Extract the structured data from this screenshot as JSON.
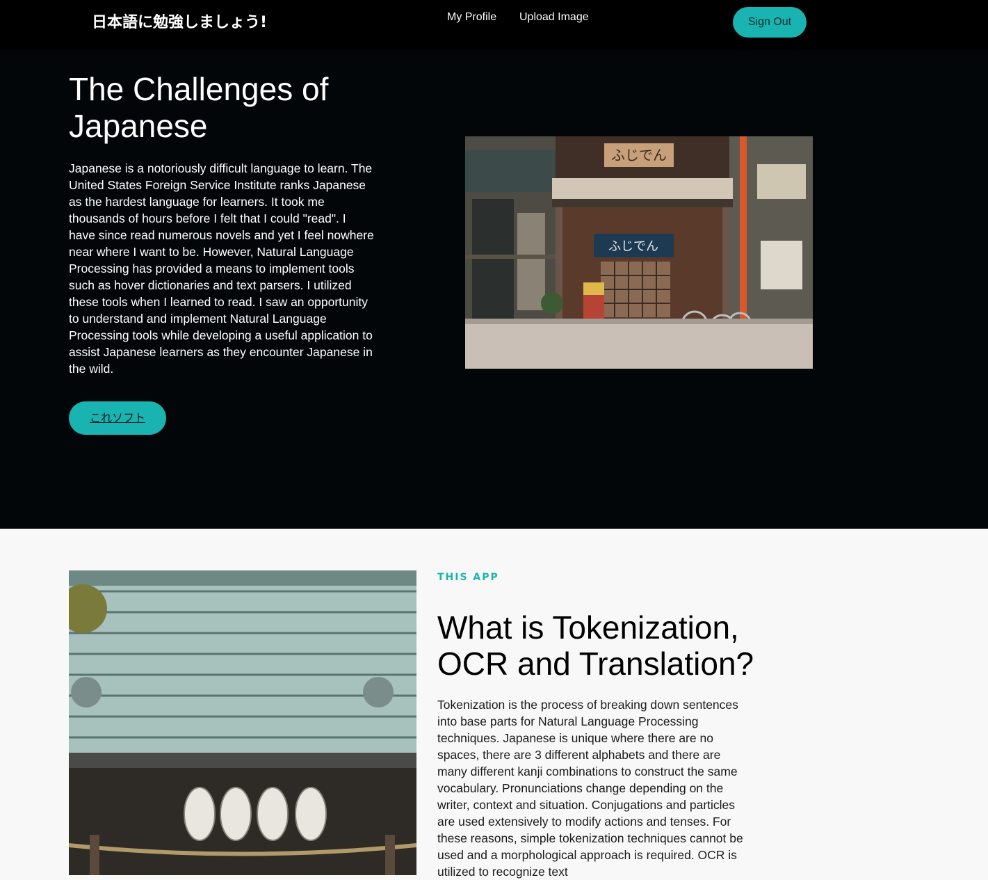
{
  "navbar": {
    "brand": "日本語に勉強しましょう!",
    "links": [
      {
        "label": "My Profile"
      },
      {
        "label": "Upload Image"
      }
    ],
    "sign_out_label": "Sign Out"
  },
  "hero": {
    "title": "The Challenges of Japanese",
    "body": "Japanese is a notoriously difficult language to learn. The United States Foreign Service Institute ranks Japanese as the hardest language for learners. It took me thousands of hours before I felt that I could \"read\". I have since read numerous novels and yet I feel nowhere near where I want to be. However, Natural Language Processing has provided a means to implement tools such as hover dictionaries and text parsers. I utilized these tools when I learned to read. I saw an opportunity to understand and implement Natural Language Processing tools while developing a useful application to assist Japanese learners as they encounter Japanese in the wild.",
    "cta_label": "これソフト",
    "photo_sign_text": "ふじでん"
  },
  "about": {
    "eyebrow": "THIS APP",
    "title": "What is Tokenization, OCR and Translation?",
    "body": "Tokenization is the process of breaking down sentences into base parts for Natural Language Processing techniques. Japanese is unique where there are no spaces, there are 3 different alphabets and there are many different kanji combinations to construct the same vocabulary. Pronunciations change depending on the writer, context and situation. Conjugations and particles are used extensively to modify actions and tenses. For these reasons, simple tokenization techniques cannot be used and a morphological approach is required. OCR is utilized to recognize text"
  },
  "colors": {
    "accent": "#19b3b1",
    "navbar_bg": "#000000",
    "hero_bg": "#020608",
    "section_bg": "#f8f8f8"
  }
}
